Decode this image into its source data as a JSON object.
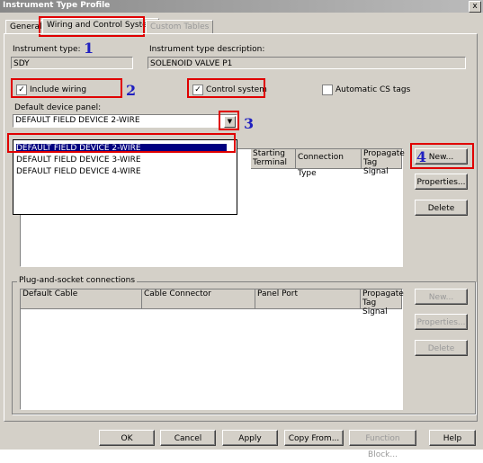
{
  "window": {
    "title": "Instrument Type Profile",
    "close_label": "x"
  },
  "tabs": [
    {
      "label": "General"
    },
    {
      "label": "Wiring and Control System"
    },
    {
      "label": "Custom Tables"
    }
  ],
  "instrument": {
    "type_label": "Instrument type:",
    "type_value": "SDY",
    "desc_label": "Instrument type description:",
    "desc_value": "SOLENOID VALVE P1"
  },
  "options": {
    "include_wiring": "Include wiring",
    "control_system": "Control system",
    "automatic_cs_tags": "Automatic CS tags",
    "check_mark": "✓"
  },
  "panel_select": {
    "label": "Default device panel:",
    "value": "DEFAULT FIELD DEVICE 2-WIRE",
    "arrow": "▼",
    "items": [
      "DEFAULT FIELD DEVICE 2-WIRE",
      "DEFAULT FIELD DEVICE 3-WIRE",
      "DEFAULT FIELD DEVICE 4-WIRE"
    ]
  },
  "upper_table": {
    "headers": [
      "Starting Terminal",
      "Connection Type",
      "Propagate Tag Signal"
    ]
  },
  "side_buttons_top": {
    "new": "New...",
    "properties": "Properties...",
    "delete": "Delete"
  },
  "plug_group": {
    "title": "Plug-and-socket connections",
    "headers": [
      "Default Cable",
      "Cable Connector",
      "Panel Port",
      "Propagate Tag Signal"
    ]
  },
  "side_buttons_bottom": {
    "new": "New...",
    "properties": "Properties...",
    "delete": "Delete"
  },
  "footer": {
    "ok": "OK",
    "cancel": "Cancel",
    "apply": "Apply",
    "copy_from": "Copy From...",
    "function_block": "Function Block...",
    "help": "Help"
  },
  "callouts": [
    "1",
    "2",
    "3",
    "4"
  ],
  "colors": {
    "annotation_box": "#e00000",
    "callout_number": "#2020c0",
    "selection": "#000080"
  }
}
